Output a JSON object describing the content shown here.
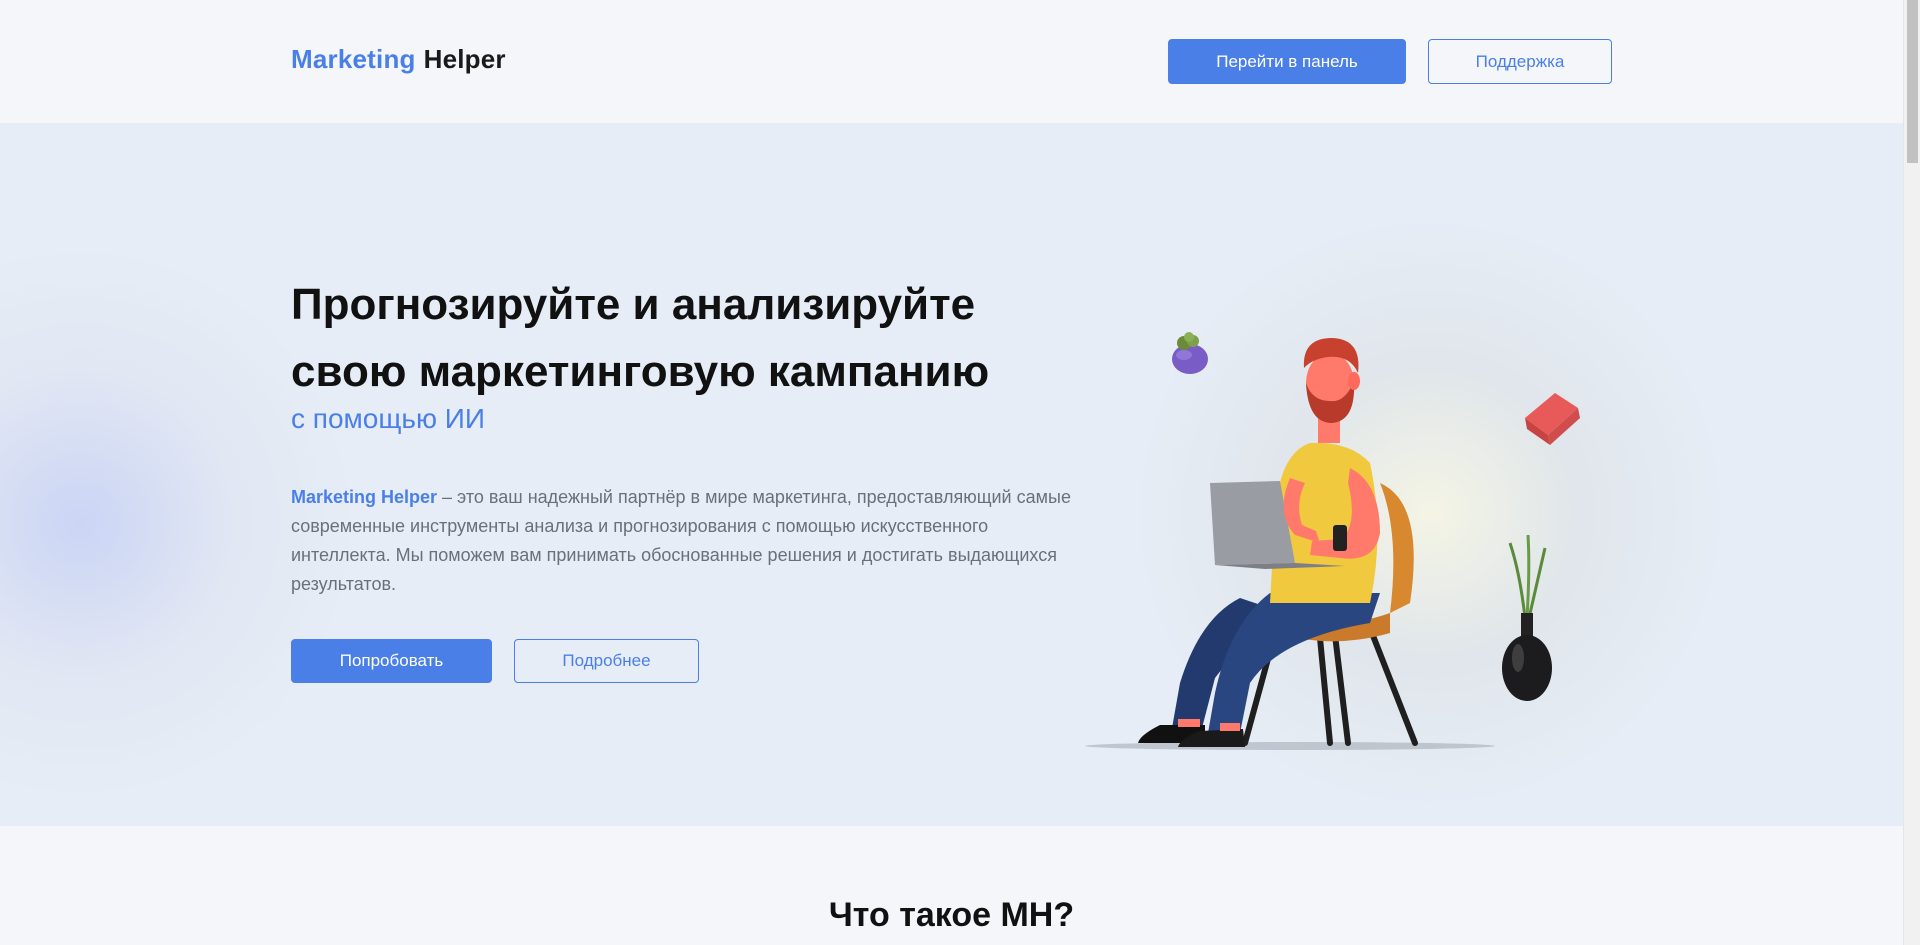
{
  "header": {
    "logo_part1": "Marketing",
    "logo_part2": "Helper",
    "panel_button": "Перейти в панель",
    "support_button": "Поддержка"
  },
  "hero": {
    "title_line1": "Прогнозируйте и анализируйте",
    "title_line2": "свою маркетинговую кампанию",
    "subtitle": "с помощью ИИ",
    "desc_brand": "Marketing Helper",
    "desc_text": " – это ваш надежный партнёр в мире маркетинга, предоставляющий самые современные инструменты анализа и прогнозирования с помощью искусственного интеллекта. Мы поможем вам принимать обоснованные решения и достигать выдающихся результатов.",
    "try_button": "Попробовать",
    "more_button": "Подробнее"
  },
  "section2": {
    "title": "Что такое MH?"
  },
  "colors": {
    "accent": "#4a7fe8",
    "hero_bg": "#e7edf6",
    "page_bg": "#f4f6fa"
  },
  "icons": {
    "illustration": "man-with-laptop-on-chair-illustration",
    "plant_pot": "succulent-pot-icon",
    "red_block": "red-block-icon",
    "vase": "vase-with-grass-icon"
  }
}
